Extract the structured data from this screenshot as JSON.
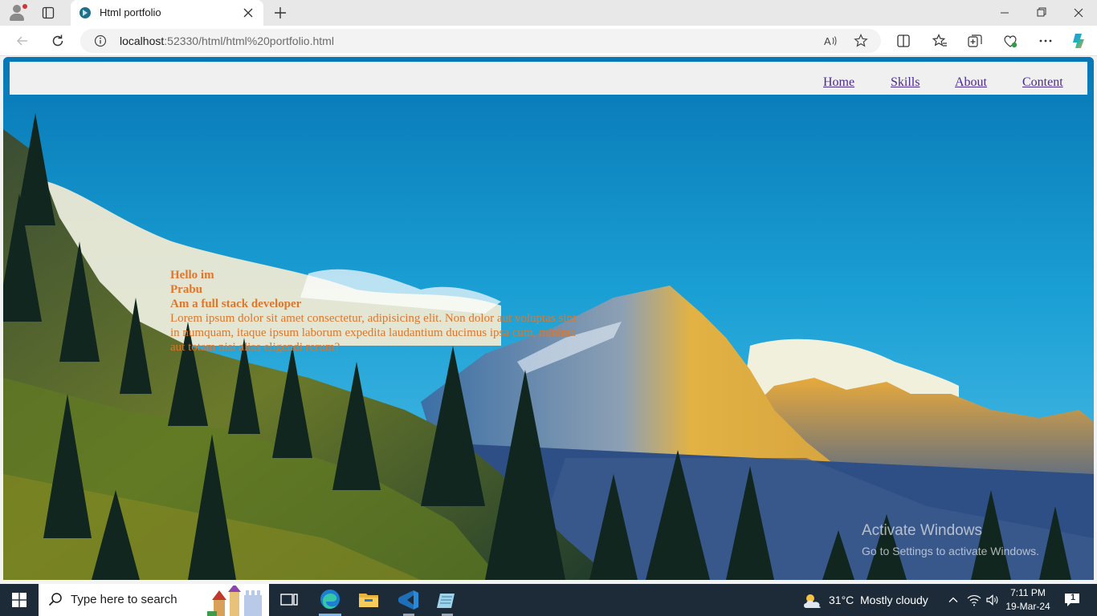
{
  "browser": {
    "tab_title": "Html portfolio",
    "url_host": "localhost",
    "url_path": ":52330/html/html%20portfolio.html"
  },
  "page": {
    "nav": [
      "Home",
      "Skills",
      "About",
      "Content"
    ],
    "hero": {
      "line1": "Hello im",
      "line2": "Prabu",
      "line3": "Am a full stack developer",
      "paragraph": "Lorem ipsum dolor sit amet consectetur, adipisicing elit. Non dolor aut voluptas sint in numquam, itaque ipsum laborum expedita laudantium ducimus ipsa cum, minima aut totam nisi alias eligendi rerum?"
    },
    "watermark": {
      "title": "Activate Windows",
      "subtitle": "Go to Settings to activate Windows."
    },
    "colors": {
      "hero_text": "#e0762a",
      "nav_link": "#4b2a8c",
      "nav_bg": "#f0f0f0"
    }
  },
  "taskbar": {
    "search_placeholder": "Type here to search",
    "weather_temp": "31°C",
    "weather_desc": "Mostly cloudy",
    "time": "7:11 PM",
    "date": "19-Mar-24",
    "notification_count": "1",
    "apps": [
      "task-view-icon",
      "edge-icon",
      "file-explorer-icon",
      "vscode-icon",
      "notepad-icon"
    ]
  }
}
